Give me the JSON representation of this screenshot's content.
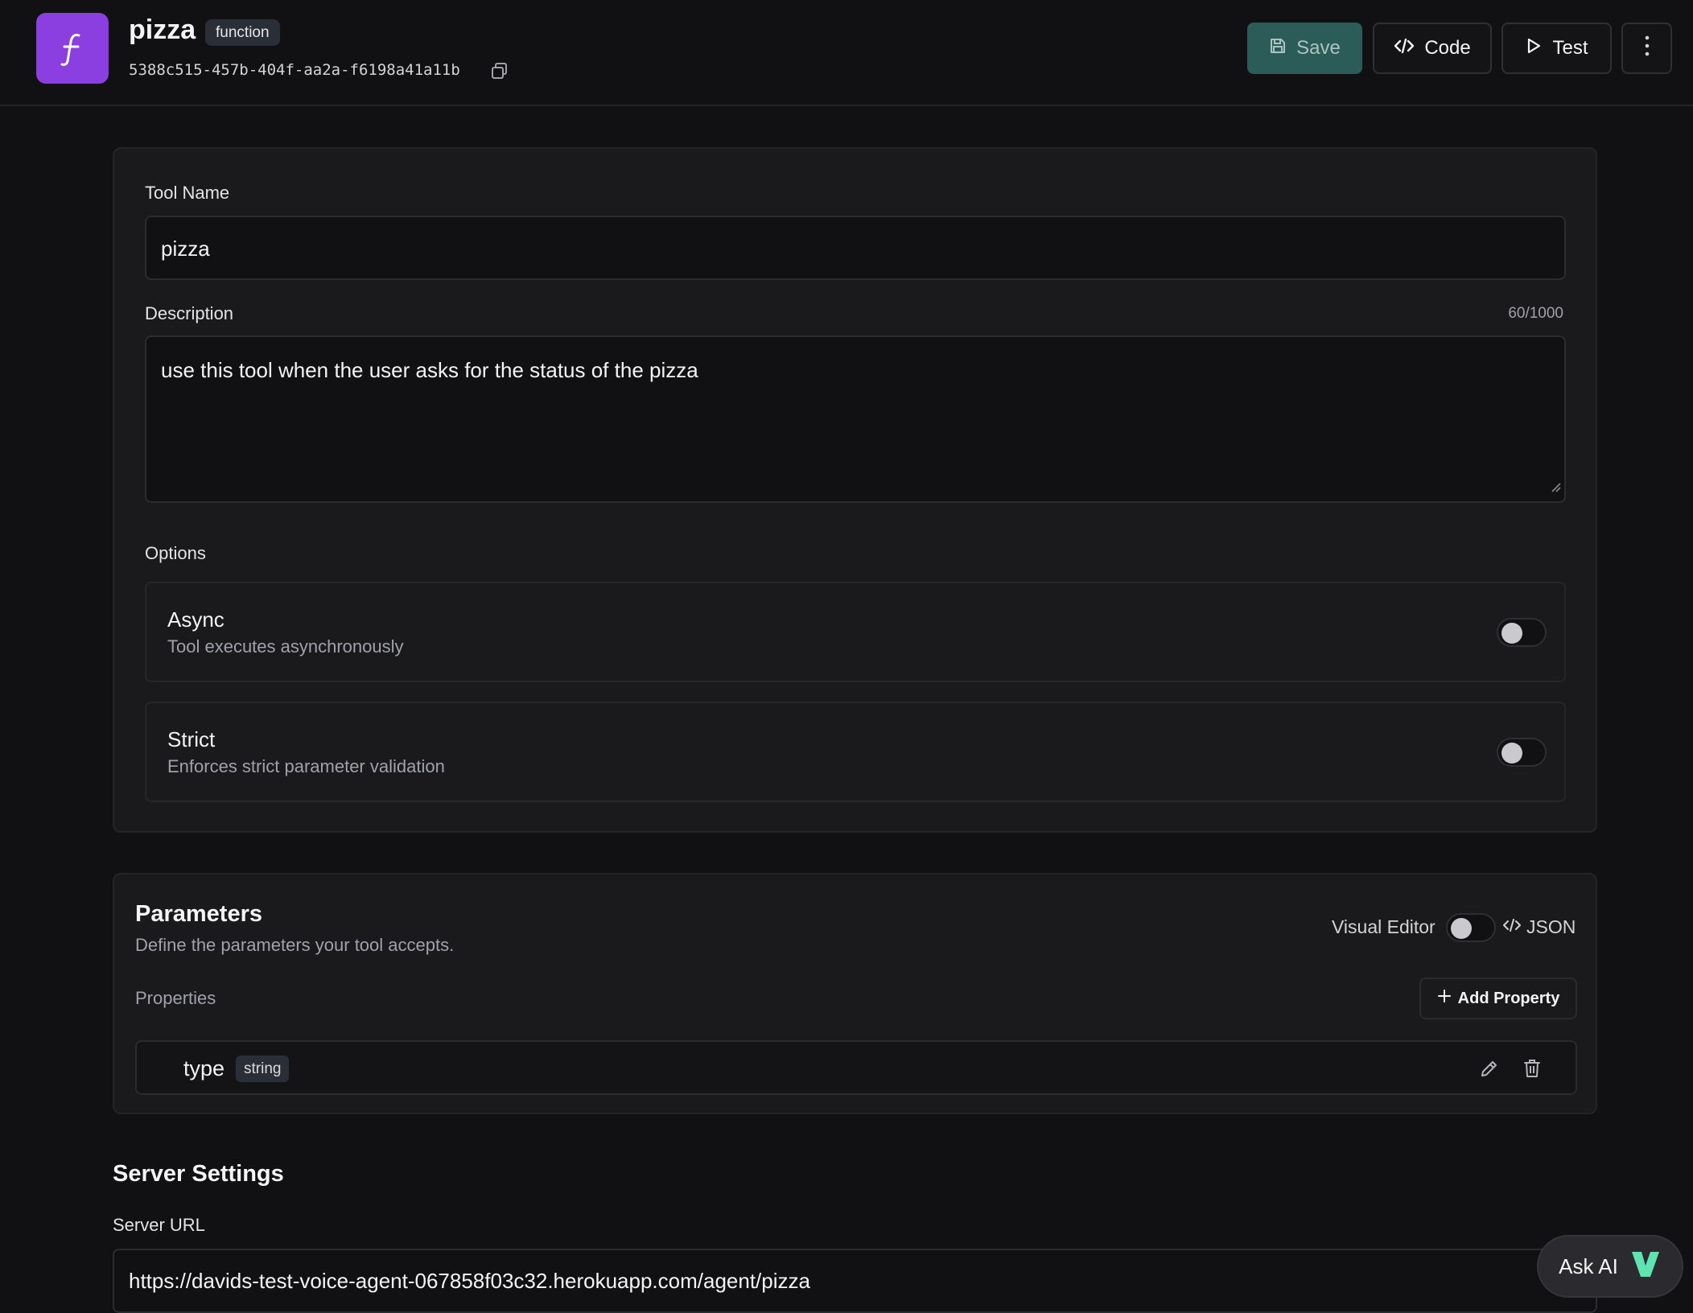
{
  "header": {
    "icon": "function-icon",
    "title": "pizza",
    "badge": "function",
    "id": "5388c515-457b-404f-aa2a-f6198a41a11b",
    "buttons": {
      "save": "Save",
      "code": "Code",
      "test": "Test"
    }
  },
  "form": {
    "tool_name_label": "Tool Name",
    "tool_name_value": "pizza",
    "description_label": "Description",
    "description_counter": "60/1000",
    "description_value": "use this tool when the user asks for the status of the pizza",
    "options_label": "Options",
    "options": [
      {
        "title": "Async",
        "description": "Tool executes asynchronously",
        "enabled": false
      },
      {
        "title": "Strict",
        "description": "Enforces strict parameter validation",
        "enabled": false
      }
    ]
  },
  "parameters": {
    "title": "Parameters",
    "subtitle": "Define the parameters your tool accepts.",
    "visual_editor_label": "Visual Editor",
    "json_label": "JSON",
    "properties_label": "Properties",
    "add_property_label": "Add Property",
    "properties": [
      {
        "name": "type",
        "type": "string"
      }
    ]
  },
  "server": {
    "title": "Server Settings",
    "url_label": "Server URL",
    "url_value": "https://davids-test-voice-agent-067858f03c32.herokuapp.com/agent/pizza"
  },
  "assistant": {
    "label": "Ask AI"
  },
  "colors": {
    "accent_purple": "#8b3fe0",
    "save_button": "#2c5c57",
    "background": "#111113",
    "card": "#1a1a1c",
    "ask_ai_logo": "#5fe3b0"
  }
}
